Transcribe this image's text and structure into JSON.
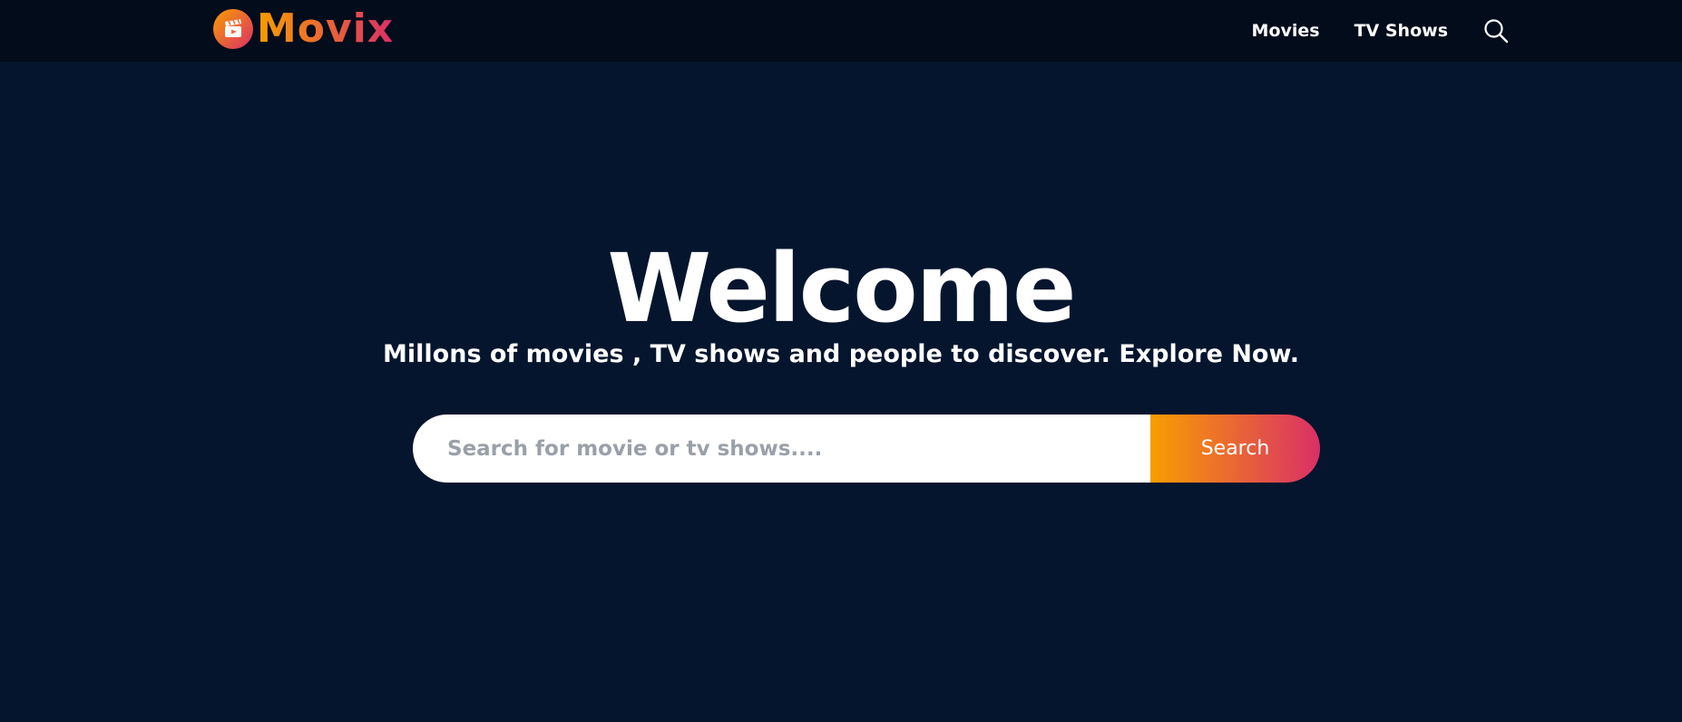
{
  "header": {
    "logo_text": "Movix",
    "logo_icon": "clapperboard-icon",
    "nav_items": [
      "Movies",
      "TV Shows"
    ],
    "search_icon": "search-icon"
  },
  "hero": {
    "title": "Welcome",
    "subtitle": "Millons of movies , TV shows and people to discover. Explore Now.",
    "search": {
      "placeholder": "Search for movie or tv shows....",
      "button_label": "Search"
    }
  },
  "colors": {
    "page_background": "#04152d",
    "header_background": "#020c1b",
    "gradient_start": "#f89e00",
    "gradient_end": "#da2f68"
  }
}
